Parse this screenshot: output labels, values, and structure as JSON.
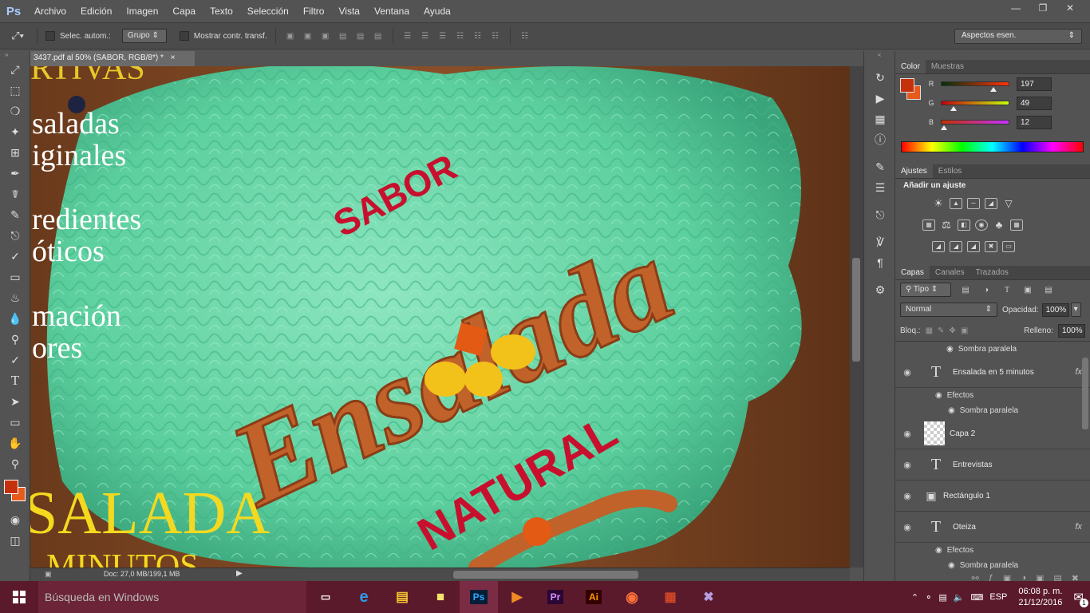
{
  "app": {
    "logo": "Ps",
    "menu": [
      "Archivo",
      "Edición",
      "Imagen",
      "Capa",
      "Texto",
      "Selección",
      "Filtro",
      "Vista",
      "Ventana",
      "Ayuda"
    ]
  },
  "options": {
    "auto_select_label": "Selec. autom.:",
    "group_value": "Grupo",
    "show_transform_label": "Mostrar contr. transf.",
    "workspace": "Aspectos esen."
  },
  "document": {
    "tab_title": "3437.pdf al 50% (SABOR, RGB/8*) *",
    "close": "×",
    "status": "Doc: 27,0 MB/199,1 MB"
  },
  "canvas_text": {
    "top_partial": "RTIVAS",
    "lines": [
      "saladas",
      "iginales",
      "redientes",
      "óticos",
      "mación",
      "ores"
    ],
    "sabor": "SABOR",
    "ensalada": "Ensalada",
    "natural": "NATURAL",
    "salada": "SALADA",
    "minutos": "MINUTOS"
  },
  "color_panel": {
    "tabs": [
      "Color",
      "Muestras"
    ],
    "r_label": "R",
    "g_label": "G",
    "b_label": "B",
    "r": "197",
    "g": "49",
    "b": "12",
    "r_fraction": 0.77,
    "g_fraction": 0.19,
    "b_fraction": 0.05,
    "fg_color": "#c5310c",
    "bg_color": "#e85a1a"
  },
  "adjust_panel": {
    "tabs": [
      "Ajustes",
      "Estilos"
    ],
    "title": "Añadir un ajuste"
  },
  "layers_panel": {
    "tabs": [
      "Capas",
      "Canales",
      "Trazados"
    ],
    "filter": "Tipo",
    "blend": "Normal",
    "opacity_label": "Opacidad:",
    "opacity": "100%",
    "lock_label": "Bloq.:",
    "fill_label": "Relleno:",
    "fill": "100%",
    "layers": {
      "top_effect": "Sombra paralela",
      "l1": {
        "name": "Ensalada en 5 minutos",
        "effects": "Efectos",
        "effect": "Sombra paralela"
      },
      "l2": {
        "name": "Capa 2"
      },
      "l3": {
        "name": "Entrevistas"
      },
      "l4": {
        "name": "Rectángulo 1"
      },
      "l5": {
        "name": "Oteiza",
        "effects": "Efectos",
        "effect": "Sombra paralela"
      }
    },
    "fx_label": "fx"
  },
  "taskbar": {
    "search_placeholder": "Búsqueda en Windows",
    "apps": [
      "Ps",
      "Pr",
      "Ai"
    ],
    "lang": "ESP",
    "time": "06:08 p. m.",
    "date": "21/12/2016",
    "notifications": "1"
  }
}
